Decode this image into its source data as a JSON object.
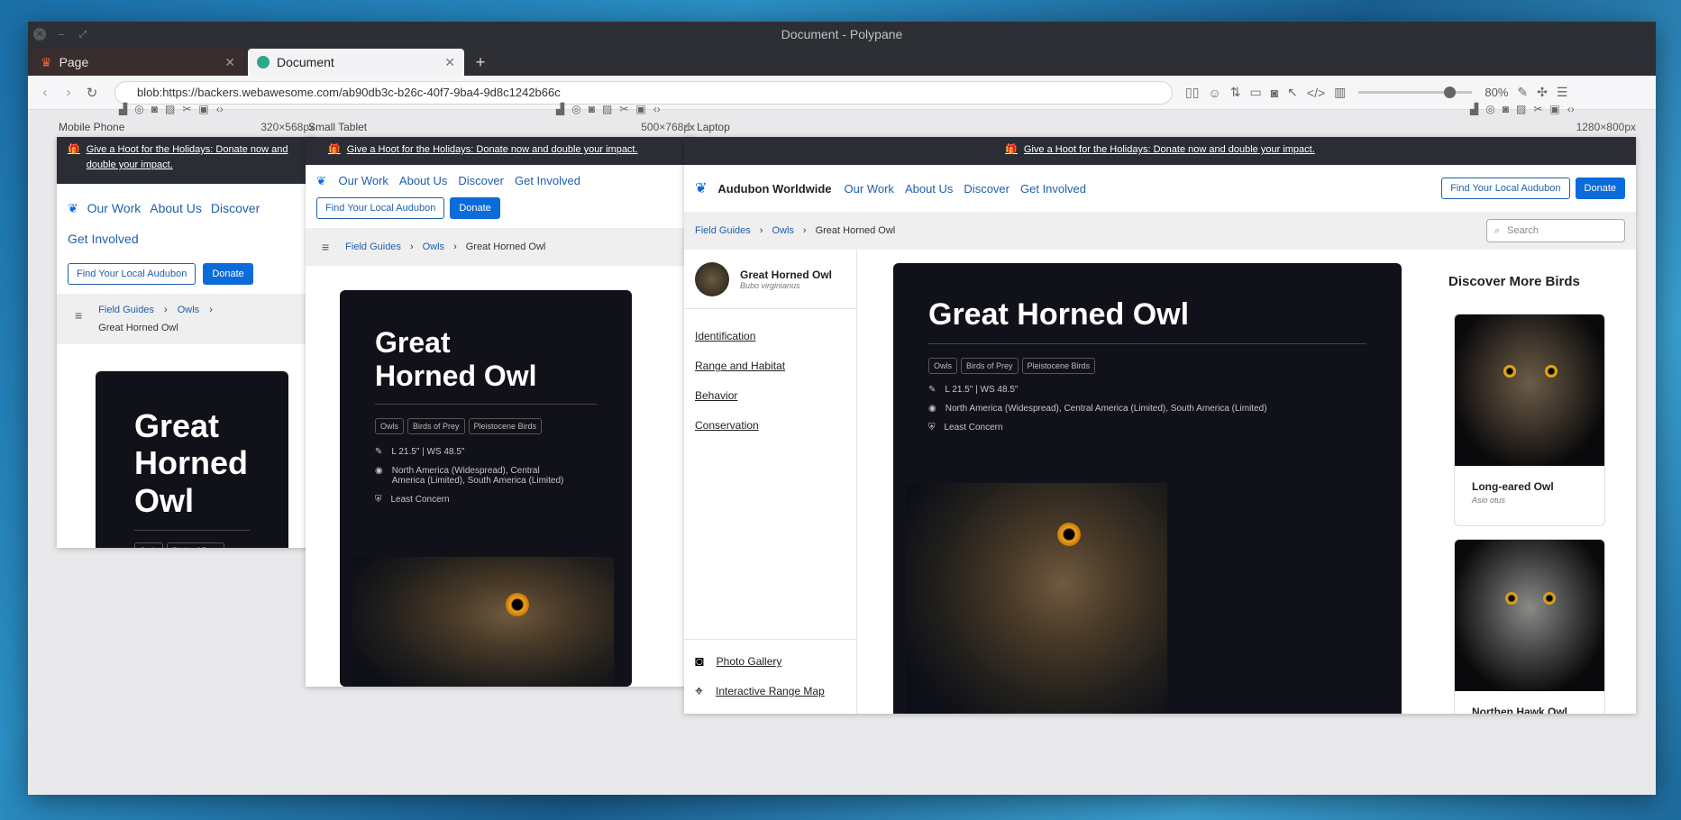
{
  "window": {
    "title": "Document - Polypane"
  },
  "tabs": [
    {
      "label": "Page"
    },
    {
      "label": "Document"
    }
  ],
  "address": {
    "url": "blob:https://backers.webawesome.com/ab90db3c-b26c-40f7-9ba4-9d8c1242b66c"
  },
  "zoom": {
    "level": "80%",
    "fraction": 0.8
  },
  "panes": [
    {
      "label": "Mobile Phone",
      "width": "320",
      "height": "568",
      "unit": "px"
    },
    {
      "label": "Small Tablet",
      "width": "500",
      "height": "768",
      "unit": "px"
    },
    {
      "label": "Laptop",
      "width": "1280",
      "height": "800",
      "unit": "px"
    }
  ],
  "dim_sep": "×",
  "site": {
    "banner": "Give a Hoot for the Holidays: Donate now and double your impact.",
    "brand": "Audubon Worldwide",
    "nav": [
      "Our Work",
      "About Us",
      "Discover",
      "Get Involved"
    ],
    "find_btn": "Find Your Local Audubon",
    "donate_btn": "Donate",
    "crumbs": [
      "Field Guides",
      "Owls",
      "Great Horned Owl"
    ],
    "search_placeholder": "Search",
    "title": "Great Horned Owl",
    "title_mobile": [
      "Great",
      "Horned",
      "Owl"
    ],
    "title_tablet": [
      "Great",
      "Horned Owl"
    ],
    "scientific": "Bubo virginianus",
    "tags": [
      "Owls",
      "Birds of Prey",
      "Pleistocene Birds"
    ],
    "size": "L 21.5\" | WS 48.5\"",
    "range": "North America (Widespread), Central America (Limited), South America (Limited)",
    "range_tablet_1": "North America (Widespread), Central",
    "range_tablet_2": "America (Limited), South America (Limited)",
    "status": "Least Concern",
    "sections": [
      "Identification",
      "Range and Habitat",
      "Behavior",
      "Conservation"
    ],
    "extra_links": [
      "Photo Gallery",
      "Interactive Range Map"
    ],
    "discover_title": "Discover More Birds",
    "more_birds": [
      {
        "name": "Long-eared Owl",
        "scientific": "Asio otus"
      },
      {
        "name": "Northen Hawk Owl",
        "scientific": ""
      }
    ]
  },
  "colors": {
    "link": "#1f5fab",
    "donate": "#0b6bdb",
    "card": "#111219",
    "banner": "#2b2d35"
  }
}
